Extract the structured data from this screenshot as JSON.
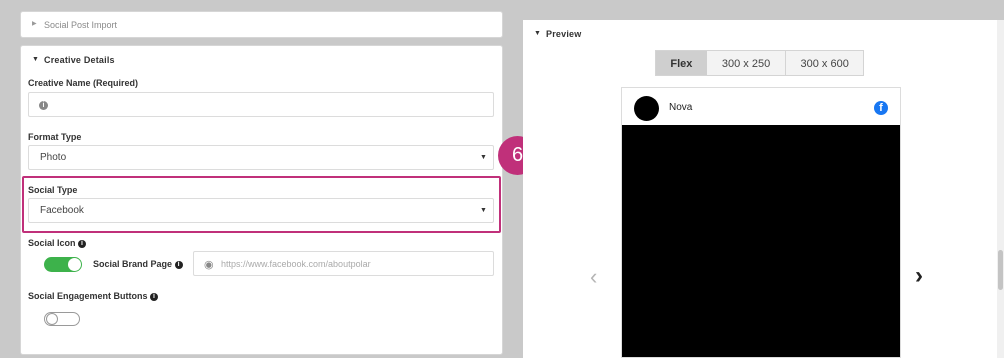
{
  "social_post_import": {
    "label": "Social Post Import"
  },
  "creative_details": {
    "title": "Creative Details",
    "creative_name": {
      "label": "Creative Name (Required)",
      "value": ""
    },
    "format_type": {
      "label": "Format Type",
      "value": "Photo"
    },
    "social_type": {
      "label": "Social Type",
      "value": "Facebook"
    },
    "social_icon": {
      "label": "Social Icon",
      "toggle_on": true
    },
    "social_brand_page": {
      "label": "Social Brand Page",
      "placeholder": "https://www.facebook.com/aboutpolar"
    },
    "social_engagement_buttons": {
      "label": "Social Engagement Buttons",
      "toggle_on": false
    }
  },
  "annotation": {
    "step_number": "6",
    "color": "#c0307a"
  },
  "preview": {
    "title": "Preview",
    "tabs": [
      {
        "label": "Flex",
        "active": true
      },
      {
        "label": "300 x 250",
        "active": false
      },
      {
        "label": "300 x 600",
        "active": false
      }
    ],
    "post": {
      "account_name": "Nova",
      "platform_icon": "facebook-icon"
    }
  },
  "colors": {
    "toggle_on": "#3db24b",
    "facebook_blue": "#1877f2",
    "highlight": "#c0307a"
  }
}
